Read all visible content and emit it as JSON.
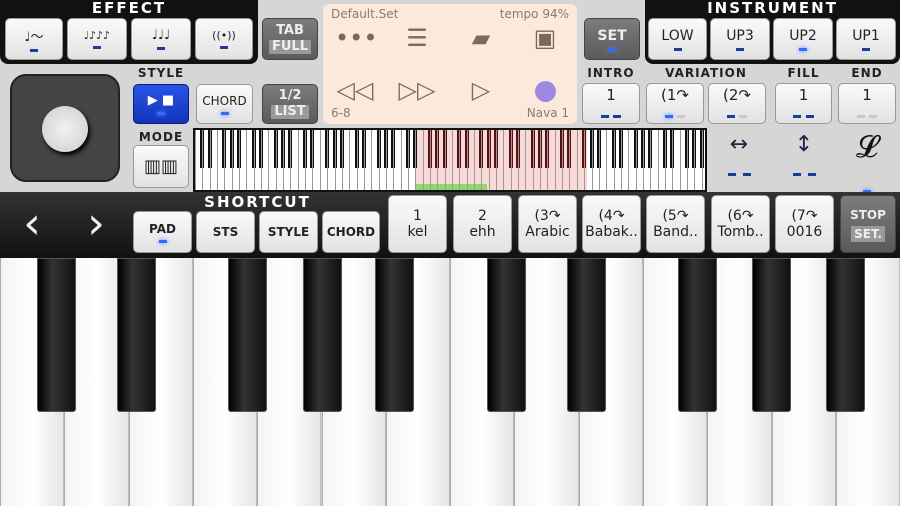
{
  "effect": {
    "title": "EFFECT",
    "buttons": [
      {
        "icon": "portamento-note-icon"
      },
      {
        "icon": "repeat-notes-icon"
      },
      {
        "icon": "triplet-notes-icon"
      },
      {
        "icon": "vibrato-icon"
      }
    ]
  },
  "tab": {
    "line1": "TAB",
    "line2": "FULL"
  },
  "list": {
    "line1": "1/2",
    "line2": "LIST"
  },
  "song": {
    "set_name": "Default.Set",
    "tempo": "tempo 94%",
    "meter": "6-8",
    "style_name": "Nava 1",
    "icons": [
      "more-icon",
      "mixer-icon",
      "folder-icon",
      "save-icon",
      "rewind-icon",
      "fast-forward-icon",
      "play-icon",
      "record-icon"
    ]
  },
  "set_label": "SET",
  "instrument": {
    "title": "INSTRUMENT",
    "buttons": [
      "LOW",
      "UP3",
      "UP2",
      "UP1"
    ],
    "active": "UP2"
  },
  "style": {
    "label": "STYLE",
    "chord": "CHORD",
    "mode": "MODE"
  },
  "sections": {
    "intro": "INTRO",
    "variation": "VARIATION",
    "fill": "FILL",
    "end": "END",
    "intro_val": "1",
    "var1": "1",
    "var2": "2",
    "fill_val": "1",
    "end_val": "1"
  },
  "shortcut": {
    "title": "SHORTCUT",
    "buttons": [
      "PAD",
      "STS",
      "STYLE",
      "CHORD"
    ]
  },
  "pads": [
    {
      "num": "1",
      "name": "kel"
    },
    {
      "num": "2",
      "name": "ehh"
    },
    {
      "num": "3",
      "name": "Arabic"
    },
    {
      "num": "4",
      "name": "Babak.."
    },
    {
      "num": "5",
      "name": "Band.."
    },
    {
      "num": "6",
      "name": "Tomb.."
    },
    {
      "num": "7",
      "name": "0016"
    }
  ],
  "stop": {
    "line1": "STOP",
    "line2": "SET."
  },
  "colors": {
    "accent": "#2f6bff",
    "style_active": "#1a3fd0",
    "panel": "#fde9dc",
    "record": "#9b8ae0"
  }
}
